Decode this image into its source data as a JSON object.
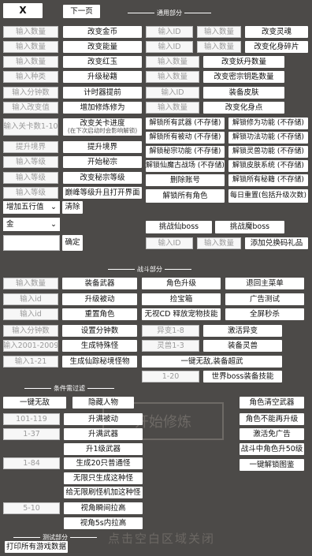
{
  "top": {
    "close": "X",
    "next_page": "下一页"
  },
  "sections": {
    "general": "通用部分",
    "battle": "战斗部分",
    "conditions": "条件需过滤",
    "test": "测试部分"
  },
  "inputs": {
    "amount": "输入数量",
    "id": "输入ID",
    "kind": "输入种类",
    "minutes": "输入分钟数",
    "change_value": "输入改变值",
    "level_range": "输入关卡数1-10",
    "raise": "提升境界",
    "level": "输入等级",
    "id_lower": "输入id",
    "range_2001_2009": "输入2001-2009",
    "range_1_21": "输入1-21",
    "foreign_1_8": "异变1-8",
    "spirit_1_3": "灵兽1-3",
    "range_1_20": "1-20",
    "range_101_119": "101-119",
    "range_1_37": "1-37",
    "range_1_84": "1-84",
    "range_5_10": "5-10"
  },
  "general": {
    "change_gold": "改变金币",
    "change_energy": "改变能量",
    "change_jade": "改变红玉",
    "upgrade_skin": "升级秘籍",
    "timer_advance": "计时器提前",
    "add_cultivation": "增加修炼修为",
    "stage_progress_l1": "改变关卡进度",
    "stage_progress_l2": "(在下次启动时会影响解锁)",
    "upgrade_realm": "提升境界",
    "open_secret": "开始秘宗",
    "change_secret_level": "改变秘宗等级",
    "peak_level": "巅峰等级升且打开界面",
    "change_soul": "改变灵魂",
    "change_fragment": "改变化身碎片",
    "change_demon_level": "改变妖丹数量",
    "change_key_count": "改变密宗钥匙数量",
    "equip_skin": "装备皮肤",
    "change_avatar_points": "改变化身点",
    "unlock_weapons": "解锁所有武器 (不存储)",
    "unlock_cultivate": "解锁修为功能 (不存储)",
    "unlock_equipped": "解锁所有被动 (不存储)",
    "unlock_skills": "解锁功法功能 (不存储)",
    "unlock_secret_func": "解锁秘宗功能 (不存储)",
    "unlock_spirit": "解锁灵兽功能 (不存储)",
    "unlock_ancient": "解锁仙魔古战场 (不存储)",
    "unlock_skin_sys": "解锁皮肤系统 (不存储)",
    "delete_account": "删除账号",
    "unlock_all_secret": "解锁所有秘籍 (不存储)",
    "unlock_roles": "解锁所有角色",
    "daily_reset": "每日重置(包括升级次数)",
    "add_element": "增加五行值",
    "clear": "清除",
    "element_value": "金",
    "confirm": "确定",
    "fairy_boss": "挑战仙boss",
    "demon_boss": "挑战魔boss",
    "add_gift_code": "添加兑换码礼品"
  },
  "battle": {
    "equip_weapon": "装备武器",
    "upgrade_passive": "升级被动",
    "reset_role": "重置角色",
    "set_minutes": "设置分钟数",
    "gen_special": "生成特殊怪",
    "gen_fairy_monster": "生成仙踪秘境怪物",
    "role_upgrade": "角色升级",
    "pick_treasure": "捡宝箱",
    "no_cd_pet": "无视CD 释放宠物技能",
    "activate_foreign": "激活异变",
    "equip_spirit": "装备灵兽",
    "one_key_invincible_equip": "一键无敌,装备超武",
    "world_boss_skill": "世界boss装备技能",
    "back_main": "退回主菜单",
    "ad_test": "广告测试",
    "screen_kill": "全屏秒杀"
  },
  "conditions": {
    "one_key_invincible": "一键无敌",
    "hide_character": "隐藏人物",
    "upgrade_passive_full": "升满被动",
    "upgrade_weapon_full": "升满武器",
    "upgrade_level_1": "升1级武器",
    "gen_20_normal": "生成20只普通怪",
    "infinite_gen": "无限只生成这种怪",
    "infinite_refresh": "给无限刷怪机加这种怪",
    "view_instant": "视角瞬间拉高",
    "view_5s": "视角5s内拉高",
    "role_clear_weapon": "角色清空武器",
    "role_cannot_upgrade": "角色不能再升级",
    "activate_ad_free": "激活免广告",
    "battle_role_50": "战斗中角色升50级",
    "unlock_codex": "一键解锁图鉴"
  },
  "test": {
    "print_all": "打印所有游戏数据"
  },
  "background": {
    "title": "开始修炼",
    "footer": "点击空白区域关闭",
    "mid_text": "开始修炼"
  }
}
